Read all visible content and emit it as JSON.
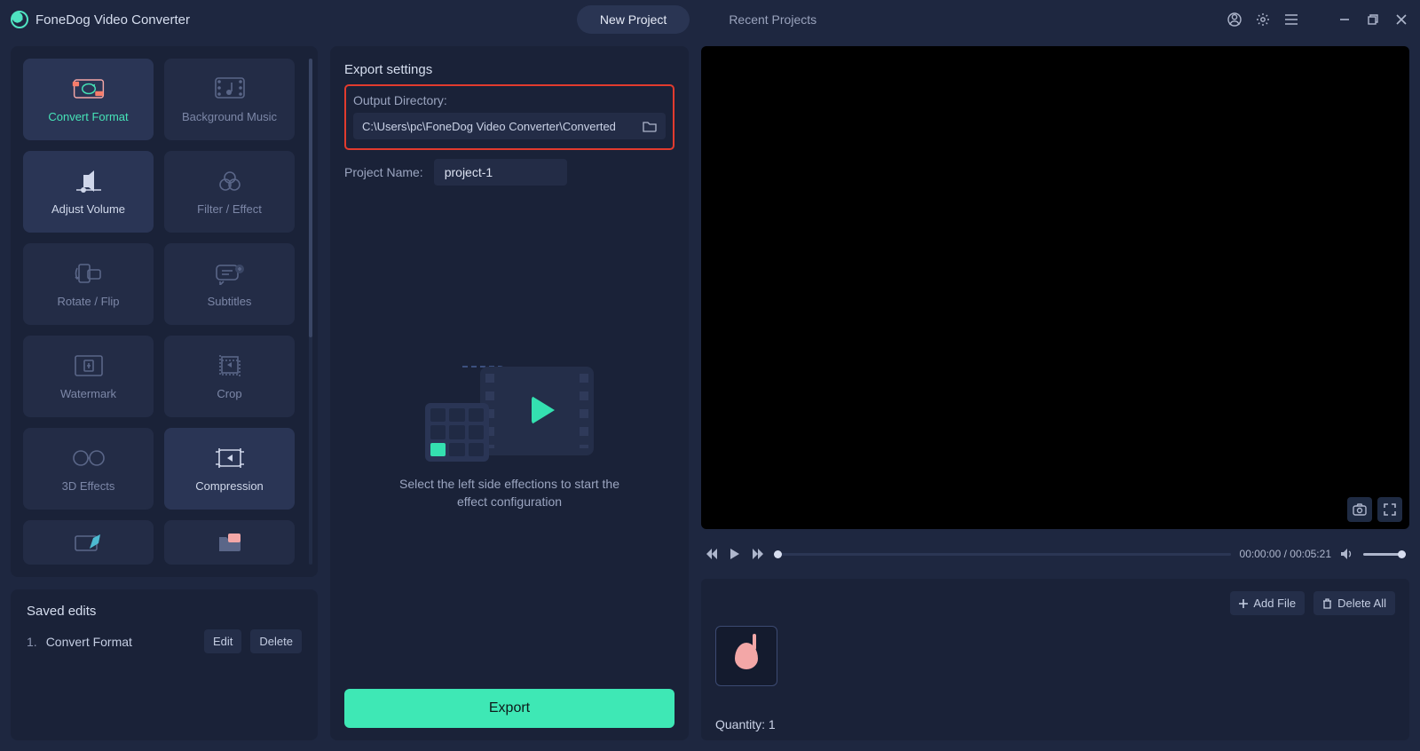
{
  "app": {
    "title": "FoneDog Video Converter"
  },
  "tabs": {
    "new_project": "New Project",
    "recent_projects": "Recent Projects"
  },
  "effects": [
    {
      "key": "convert-format",
      "label": "Convert Format",
      "icon": "convert"
    },
    {
      "key": "background-music",
      "label": "Background Music",
      "icon": "music"
    },
    {
      "key": "adjust-volume",
      "label": "Adjust Volume",
      "icon": "volume"
    },
    {
      "key": "filter-effect",
      "label": "Filter / Effect",
      "icon": "filter"
    },
    {
      "key": "rotate-flip",
      "label": "Rotate / Flip",
      "icon": "rotate"
    },
    {
      "key": "subtitles",
      "label": "Subtitles",
      "icon": "subtitles"
    },
    {
      "key": "watermark",
      "label": "Watermark",
      "icon": "watermark"
    },
    {
      "key": "crop",
      "label": "Crop",
      "icon": "crop"
    },
    {
      "key": "3d-effects",
      "label": "3D Effects",
      "icon": "3d"
    },
    {
      "key": "compression",
      "label": "Compression",
      "icon": "compress"
    }
  ],
  "saved": {
    "title": "Saved edits",
    "items": [
      {
        "index": "1.",
        "name": "Convert Format"
      }
    ],
    "edit_btn": "Edit",
    "delete_btn": "Delete"
  },
  "export": {
    "title": "Export settings",
    "output_label": "Output Directory:",
    "output_path": "C:\\Users\\pc\\FoneDog Video Converter\\Converted",
    "project_label": "Project Name:",
    "project_name": "project-1",
    "hint": "Select the left side effections to start the effect configuration",
    "export_btn": "Export"
  },
  "player": {
    "time_current": "00:00:00",
    "time_total": "00:05:21",
    "separator": " / "
  },
  "strip": {
    "add_file": "Add File",
    "delete_all": "Delete All",
    "quantity_label": "Quantity: ",
    "quantity_value": "1"
  }
}
